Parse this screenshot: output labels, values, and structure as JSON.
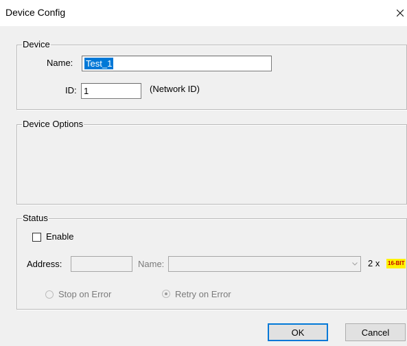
{
  "window": {
    "title": "Device Config"
  },
  "device": {
    "legend": "Device",
    "name_label": "Name:",
    "name_value": "Test_1",
    "id_label": "ID:",
    "id_value": "1",
    "id_hint": "(Network ID)"
  },
  "device_options": {
    "legend": "Device Options"
  },
  "status": {
    "legend": "Status",
    "enable_label": "Enable",
    "enable_checked": false,
    "address_label": "Address:",
    "address_value": "",
    "name_label": "Name:",
    "name_value": "",
    "multiplier": "2 x",
    "bit_badge": "16-BIT",
    "stop_on_error_label": "Stop on Error",
    "retry_on_error_label": "Retry on Error",
    "selected_error_mode": "Retry on Error"
  },
  "footer": {
    "ok_label": "OK",
    "cancel_label": "Cancel"
  },
  "icons": {
    "close": "close-icon",
    "dropdown": "chevron-down-icon"
  }
}
